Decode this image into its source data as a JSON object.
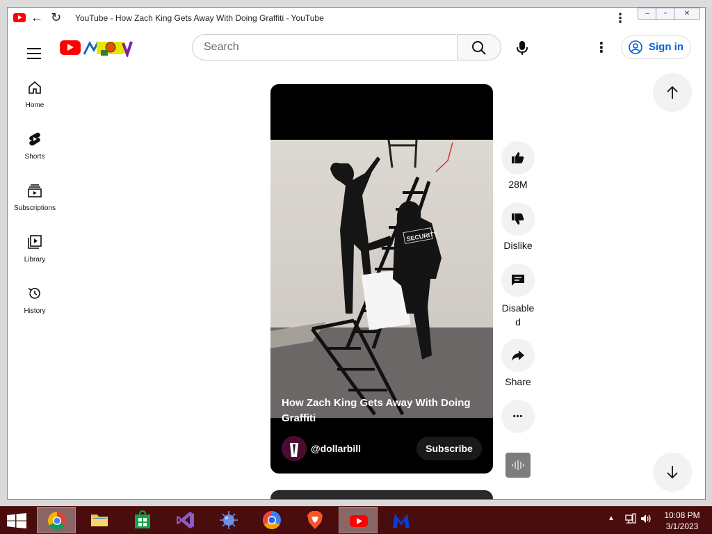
{
  "browser": {
    "tab_title": "YouTube - How Zach King Gets Away With Doing Graffiti - YouTube",
    "back_glyph": "←",
    "reload_glyph": "↻",
    "menu_glyph": "⋮",
    "window_controls": {
      "minimize": "‒",
      "maximize": "▫",
      "close": "✕"
    }
  },
  "masthead": {
    "search_placeholder": "Search",
    "more_glyph": "⋮",
    "sign_in_label": "Sign in",
    "brand_color": "#ff0000",
    "link_color": "#065fd4"
  },
  "guide": {
    "items": [
      {
        "label": "Home",
        "icon": "home-icon"
      },
      {
        "label": "Shorts",
        "icon": "shorts-icon"
      },
      {
        "label": "Subscriptions",
        "icon": "subscriptions-icon"
      },
      {
        "label": "Library",
        "icon": "library-icon"
      },
      {
        "label": "History",
        "icon": "history-icon"
      }
    ]
  },
  "short": {
    "title": "How Zach King Gets Away With Doing Graffiti",
    "channel": "@dollarbill",
    "subscribe_label": "Subscribe",
    "security_text": "SECURITY"
  },
  "actions": {
    "like_label": "28M",
    "dislike_label": "Dislike",
    "comments_label": "Disable\nd",
    "share_label": "Share",
    "more_glyph": "•••"
  },
  "taskbar": {
    "apps": [
      "chrome",
      "file-explorer",
      "store",
      "visual-studio",
      "malware-tool",
      "chromium-browser",
      "brave",
      "youtube",
      "malwarebytes"
    ],
    "active_app": "youtube",
    "tray_arrow": "▲",
    "time": "10:08 PM",
    "date": "3/1/2023",
    "bar_color": "#4a0d0d"
  }
}
